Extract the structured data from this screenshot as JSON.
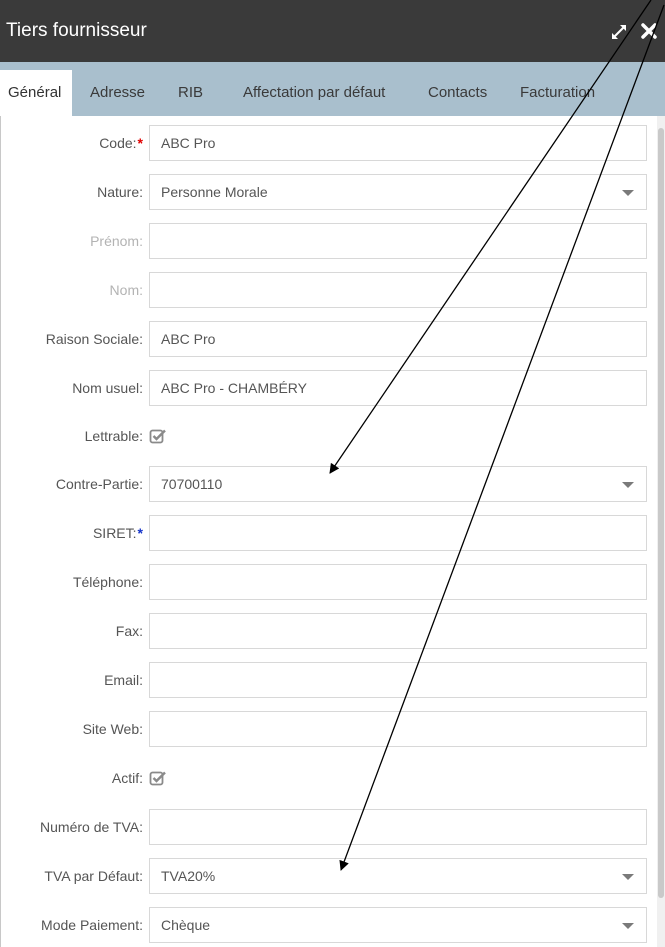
{
  "window": {
    "title": "Tiers fournisseur",
    "expand_icon": "expand-icon",
    "close_icon": "close-icon"
  },
  "tabs": [
    {
      "label": "Général",
      "active": true
    },
    {
      "label": "Adresse"
    },
    {
      "label": "RIB"
    },
    {
      "label": "Affectation par défaut"
    },
    {
      "label": "Contacts"
    },
    {
      "label": "Facturation"
    }
  ],
  "form": {
    "code": {
      "label": "Code:",
      "required": "*",
      "value": "ABC Pro"
    },
    "nature": {
      "label": "Nature:",
      "value": "Personne Morale"
    },
    "prenom": {
      "label": "Prénom:",
      "value": ""
    },
    "nom": {
      "label": "Nom:",
      "value": ""
    },
    "raison_sociale": {
      "label": "Raison Sociale:",
      "value": "ABC Pro"
    },
    "nom_usuel": {
      "label": "Nom usuel:",
      "value": "ABC Pro - CHAMBÉRY"
    },
    "lettrable": {
      "label": "Lettrable:",
      "checked": true
    },
    "contre_partie": {
      "label": "Contre-Partie:",
      "value": "70700110"
    },
    "siret": {
      "label": "SIRET:",
      "required": "*",
      "value": ""
    },
    "telephone": {
      "label": "Téléphone:",
      "value": ""
    },
    "fax": {
      "label": "Fax:",
      "value": ""
    },
    "email": {
      "label": "Email:",
      "value": ""
    },
    "site_web": {
      "label": "Site Web:",
      "value": ""
    },
    "actif": {
      "label": "Actif:",
      "checked": true
    },
    "numero_tva": {
      "label": "Numéro de TVA:",
      "value": ""
    },
    "tva_defaut": {
      "label": "TVA par Défaut:",
      "value": "TVA20%"
    },
    "mode_paiement": {
      "label": "Mode Paiement:",
      "value": "Chèque"
    }
  },
  "colors": {
    "titlebar": "#3a3a3a",
    "tabbar": "#a9bfcd",
    "required_red": "#e00000",
    "required_blue": "#1533c9"
  }
}
